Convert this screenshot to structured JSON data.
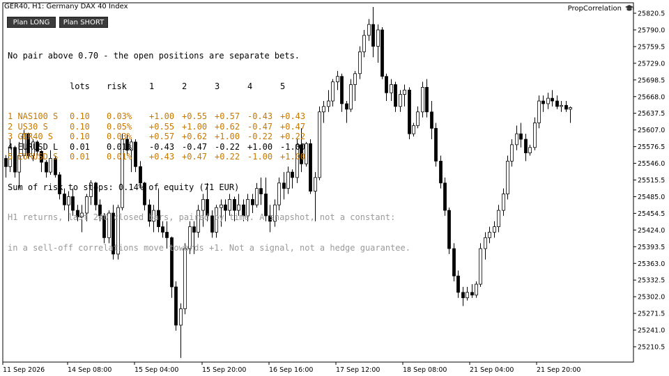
{
  "window": {
    "title": "GER40, H1:  Germany DAX 40 Index",
    "brand": "PropCorrelation"
  },
  "buttons": {
    "plan_long": "Plan LONG",
    "plan_short": "Plan SHORT"
  },
  "panel": {
    "headline": "No pair above 0.70 - the open positions are separate bets.",
    "columns": [
      "lots",
      "risk",
      "1",
      "2",
      "3",
      "4",
      "5"
    ],
    "rows": [
      {
        "label": "1 NAS100 S",
        "lots": "0.10",
        "risk": "0.03%",
        "c": [
          "+1.00",
          "+0.55",
          "+0.57",
          "-0.43",
          "+0.43"
        ],
        "style": "warn"
      },
      {
        "label": "2 US30 S",
        "lots": "0.10",
        "risk": "0.05%",
        "c": [
          "+0.55",
          "+1.00",
          "+0.62",
          "-0.47",
          "+0.47"
        ],
        "style": "warn"
      },
      {
        "label": "3 GER40 S",
        "lots": "0.10",
        "risk": "0.03%",
        "c": [
          "+0.57",
          "+0.62",
          "+1.00",
          "-0.22",
          "+0.22"
        ],
        "style": "warn"
      },
      {
        "label": "4 EURUSD L",
        "lots": "0.01",
        "risk": "0.01%",
        "c": [
          "-0.43",
          "-0.47",
          "-0.22",
          "+1.00",
          "-1.00"
        ],
        "style": "norm"
      },
      {
        "label": "5 EURUSD S",
        "lots": "0.01",
        "risk": "0.01%",
        "c": [
          "+0.43",
          "+0.47",
          "+0.22",
          "-1.00",
          "+1.00"
        ],
        "style": "warn"
      }
    ],
    "sum": "Sum of risk to stops: 0.14% of equity (71 EUR)",
    "note1": "H1 returns, last 240 closed bars, paired by time. A snapshot, not a constant:",
    "note2": "in a sell-off correlations move towards +1. Not a signal, not a hedge guarantee."
  },
  "chart_data": {
    "type": "candlestick",
    "y_axis_labels": [
      "25820.5",
      "25790.0",
      "25759.5",
      "25729.0",
      "25698.5",
      "25668.0",
      "25637.5",
      "25607.0",
      "25576.5",
      "25546.0",
      "25515.5",
      "25485.0",
      "25454.5",
      "25424.0",
      "25393.5",
      "25363.0",
      "25332.5",
      "25302.0",
      "25271.5",
      "25241.0",
      "25210.5"
    ],
    "x_axis_labels": [
      "11 Sep 2026",
      "14 Sep 08:00",
      "15 Sep 04:00",
      "15 Sep 20:00",
      "16 Sep 16:00",
      "17 Sep 12:00",
      "18 Sep 08:00",
      "21 Sep 04:00",
      "21 Sep 20:00"
    ],
    "ylim": [
      25192,
      25830
    ],
    "ohlc": [
      [
        25555,
        25561,
        25520,
        25540
      ],
      [
        25540,
        25590,
        25530,
        25575
      ],
      [
        25575,
        25578,
        25520,
        25530
      ],
      [
        25530,
        25585,
        25500,
        25560
      ],
      [
        25560,
        25607,
        25555,
        25600
      ],
      [
        25600,
        25602,
        25555,
        25560
      ],
      [
        25560,
        25590,
        25550,
        25585
      ],
      [
        25585,
        25588,
        25560,
        25568
      ],
      [
        25568,
        25570,
        25530,
        25548
      ],
      [
        25548,
        25552,
        25520,
        25530
      ],
      [
        25530,
        25570,
        25525,
        25555
      ],
      [
        25555,
        25560,
        25520,
        25525
      ],
      [
        25525,
        25530,
        25480,
        25490
      ],
      [
        25490,
        25500,
        25460,
        25470
      ],
      [
        25470,
        25495,
        25440,
        25485
      ],
      [
        25485,
        25500,
        25450,
        25460
      ],
      [
        25460,
        25470,
        25440,
        25448
      ],
      [
        25448,
        25470,
        25420,
        25455
      ],
      [
        25455,
        25490,
        25440,
        25485
      ],
      [
        25485,
        25515,
        25470,
        25510
      ],
      [
        25510,
        25512,
        25460,
        25470
      ],
      [
        25470,
        25480,
        25440,
        25450
      ],
      [
        25450,
        25455,
        25400,
        25410
      ],
      [
        25410,
        25460,
        25400,
        25455
      ],
      [
        25455,
        25470,
        25370,
        25380
      ],
      [
        25380,
        25470,
        25370,
        25465
      ],
      [
        25465,
        25600,
        25460,
        25590
      ],
      [
        25590,
        25600,
        25560,
        25570
      ],
      [
        25570,
        25590,
        25530,
        25585
      ],
      [
        25585,
        25590,
        25530,
        25540
      ],
      [
        25540,
        25550,
        25500,
        25510
      ],
      [
        25510,
        25512,
        25460,
        25470
      ],
      [
        25470,
        25480,
        25430,
        25440
      ],
      [
        25440,
        25470,
        25420,
        25460
      ],
      [
        25460,
        25500,
        25420,
        25430
      ],
      [
        25430,
        25440,
        25410,
        25420
      ],
      [
        25420,
        25440,
        25390,
        25410
      ],
      [
        25410,
        25412,
        25300,
        25320
      ],
      [
        25320,
        25330,
        25240,
        25250
      ],
      [
        25250,
        25290,
        25190,
        25280
      ],
      [
        25280,
        25400,
        25270,
        25390
      ],
      [
        25390,
        25440,
        25380,
        25430
      ],
      [
        25430,
        25440,
        25380,
        25420
      ],
      [
        25420,
        25470,
        25410,
        25460
      ],
      [
        25460,
        25490,
        25430,
        25480
      ],
      [
        25480,
        25510,
        25440,
        25450
      ],
      [
        25450,
        25460,
        25410,
        25420
      ],
      [
        25420,
        25470,
        25410,
        25465
      ],
      [
        25465,
        25480,
        25430,
        25470
      ],
      [
        25470,
        25480,
        25440,
        25460
      ],
      [
        25460,
        25490,
        25450,
        25480
      ],
      [
        25480,
        25485,
        25440,
        25460
      ],
      [
        25460,
        25490,
        25450,
        25470
      ],
      [
        25470,
        25480,
        25440,
        25450
      ],
      [
        25450,
        25490,
        25440,
        25480
      ],
      [
        25480,
        25490,
        25455,
        25470
      ],
      [
        25470,
        25510,
        25465,
        25500
      ],
      [
        25500,
        25520,
        25470,
        25490
      ],
      [
        25490,
        25520,
        25440,
        25450
      ],
      [
        25450,
        25470,
        25420,
        25440
      ],
      [
        25440,
        25480,
        25430,
        25470
      ],
      [
        25470,
        25520,
        25460,
        25510
      ],
      [
        25510,
        25530,
        25480,
        25500
      ],
      [
        25500,
        25540,
        25490,
        25530
      ],
      [
        25530,
        25535,
        25500,
        25520
      ],
      [
        25520,
        25590,
        25510,
        25580
      ],
      [
        25580,
        25610,
        25530,
        25545
      ],
      [
        25545,
        25585,
        25540,
        25582
      ],
      [
        25582,
        25590,
        25490,
        25495
      ],
      [
        25495,
        25530,
        25440,
        25520
      ],
      [
        25520,
        25650,
        25515,
        25640
      ],
      [
        25640,
        25660,
        25620,
        25650
      ],
      [
        25650,
        25680,
        25640,
        25660
      ],
      [
        25660,
        25700,
        25650,
        25695
      ],
      [
        25695,
        25715,
        25680,
        25705
      ],
      [
        25705,
        25710,
        25640,
        25655
      ],
      [
        25655,
        25660,
        25620,
        25645
      ],
      [
        25645,
        25700,
        25640,
        25690
      ],
      [
        25690,
        25715,
        25660,
        25710
      ],
      [
        25710,
        25760,
        25700,
        25750
      ],
      [
        25750,
        25790,
        25740,
        25780
      ],
      [
        25780,
        25810,
        25770,
        25800
      ],
      [
        25800,
        25832,
        25740,
        25760
      ],
      [
        25760,
        25800,
        25730,
        25790
      ],
      [
        25790,
        25795,
        25700,
        25705
      ],
      [
        25705,
        25710,
        25660,
        25675
      ],
      [
        25675,
        25700,
        25660,
        25690
      ],
      [
        25690,
        25695,
        25640,
        25650
      ],
      [
        25650,
        25680,
        25640,
        25672
      ],
      [
        25672,
        25690,
        25650,
        25680
      ],
      [
        25680,
        25685,
        25590,
        25600
      ],
      [
        25600,
        25620,
        25595,
        25615
      ],
      [
        25615,
        25650,
        25610,
        25640
      ],
      [
        25640,
        25695,
        25630,
        25685
      ],
      [
        25685,
        25700,
        25630,
        25640
      ],
      [
        25640,
        25660,
        25590,
        25610
      ],
      [
        25610,
        25620,
        25540,
        25550
      ],
      [
        25550,
        25560,
        25500,
        25510
      ],
      [
        25510,
        25520,
        25450,
        25460
      ],
      [
        25460,
        25465,
        25380,
        25390
      ],
      [
        25390,
        25400,
        25330,
        25340
      ],
      [
        25340,
        25350,
        25300,
        25310
      ],
      [
        25310,
        25320,
        25285,
        25300
      ],
      [
        25300,
        25320,
        25295,
        25310
      ],
      [
        25310,
        25325,
        25300,
        25305
      ],
      [
        25305,
        25330,
        25300,
        25325
      ],
      [
        25325,
        25400,
        25320,
        25390
      ],
      [
        25390,
        25420,
        25370,
        25410
      ],
      [
        25410,
        25430,
        25400,
        25420
      ],
      [
        25420,
        25440,
        25410,
        25430
      ],
      [
        25430,
        25470,
        25420,
        25460
      ],
      [
        25460,
        25500,
        25450,
        25490
      ],
      [
        25490,
        25560,
        25480,
        25550
      ],
      [
        25550,
        25590,
        25540,
        25580
      ],
      [
        25580,
        25615,
        25570,
        25600
      ],
      [
        25600,
        25620,
        25575,
        25590
      ],
      [
        25590,
        25600,
        25550,
        25565
      ],
      [
        25565,
        25580,
        25560,
        25575
      ],
      [
        25575,
        25630,
        25570,
        25620
      ],
      [
        25620,
        25670,
        25610,
        25660
      ],
      [
        25660,
        25670,
        25640,
        25655
      ],
      [
        25655,
        25675,
        25645,
        25665
      ],
      [
        25665,
        25680,
        25650,
        25660
      ],
      [
        25660,
        25670,
        25645,
        25650
      ],
      [
        25650,
        25660,
        25640,
        25652
      ],
      [
        25652,
        25660,
        25640,
        25645
      ],
      [
        25645,
        25650,
        25620,
        25648
      ]
    ]
  }
}
